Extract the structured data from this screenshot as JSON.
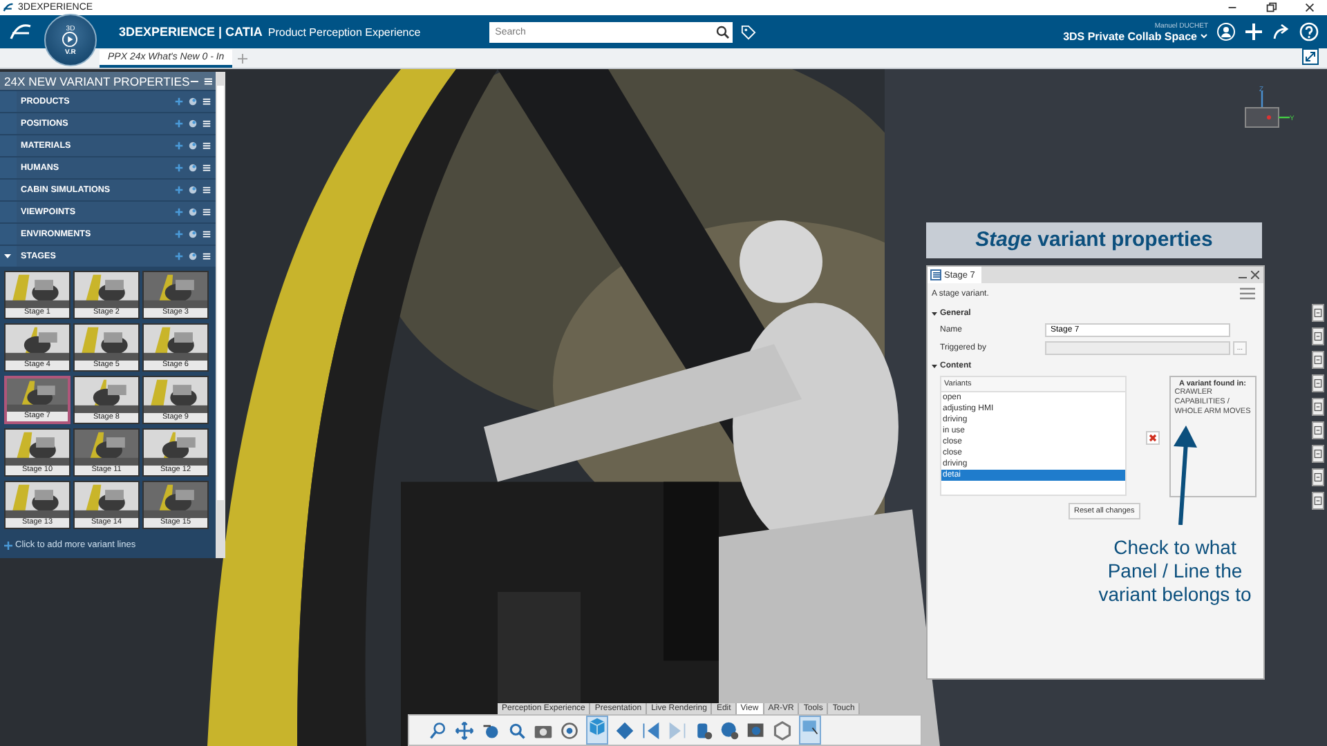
{
  "app_title": "3DEXPERIENCE",
  "header": {
    "brand": "3DEXPERIENCE | CATIA",
    "product": "Product Perception Experience",
    "compass_top": "3D",
    "compass_bottom": "V.R",
    "search": {
      "placeholder": "Search"
    },
    "user": "Manuel DUCHET",
    "space": "3DS Private Collab Space"
  },
  "tabs": [
    {
      "label": "PPX 24x What's New 0 - In",
      "selected": true
    }
  ],
  "variant_panel": {
    "title": "24X NEW VARIANT PROPERTIES",
    "categories": [
      {
        "label": "PRODUCTS",
        "expanded": false
      },
      {
        "label": "POSITIONS",
        "expanded": false
      },
      {
        "label": "MATERIALS",
        "expanded": false
      },
      {
        "label": "HUMANS",
        "expanded": false
      },
      {
        "label": "CABIN SIMULATIONS",
        "expanded": false
      },
      {
        "label": "VIEWPOINTS",
        "expanded": false
      },
      {
        "label": "ENVIRONMENTS",
        "expanded": false
      },
      {
        "label": "STAGES",
        "expanded": true
      }
    ],
    "stages": [
      {
        "label": "Stage 1",
        "selected": false
      },
      {
        "label": "Stage 2",
        "selected": false
      },
      {
        "label": "Stage 3",
        "selected": false
      },
      {
        "label": "Stage 4",
        "selected": false
      },
      {
        "label": "Stage 5",
        "selected": false
      },
      {
        "label": "Stage 6",
        "selected": false
      },
      {
        "label": "Stage 7",
        "selected": true
      },
      {
        "label": "Stage 8",
        "selected": false
      },
      {
        "label": "Stage 9",
        "selected": false
      },
      {
        "label": "Stage 10",
        "selected": false
      },
      {
        "label": "Stage 11",
        "selected": false
      },
      {
        "label": "Stage 12",
        "selected": false
      },
      {
        "label": "Stage 13",
        "selected": false
      },
      {
        "label": "Stage 14",
        "selected": false
      },
      {
        "label": "Stage 15",
        "selected": false
      }
    ],
    "add_hint": "Click to add more variant lines"
  },
  "stage_banner": "*Stage* variant properties",
  "dialog": {
    "tab": "Stage 7",
    "description": "A stage variant.",
    "general_title": "General",
    "fields": [
      {
        "label": "Name",
        "value": "Stage 7"
      },
      {
        "label": "Triggered by"
      }
    ],
    "browse_label": "...",
    "content_title": "Content",
    "variants_header": "Variants",
    "variants": [
      {
        "label": "open",
        "selected": false
      },
      {
        "label": "adjusting HMI",
        "selected": false
      },
      {
        "label": "driving",
        "selected": false
      },
      {
        "label": "in use",
        "selected": false
      },
      {
        "label": "close",
        "selected": false
      },
      {
        "label": "close",
        "selected": false
      },
      {
        "label": "driving",
        "selected": false
      },
      {
        "label": "detai",
        "selected": true
      }
    ],
    "found_in": {
      "title": "A variant found in:",
      "lines": [
        "CRAWLER",
        "CAPABILITIES /",
        "WHOLE ARM MOVES"
      ]
    },
    "reset_button": "Reset all changes"
  },
  "annotation": "Check to what Panel / Line the variant belongs to",
  "axis_labels": {
    "z": "Z",
    "y": "Y"
  },
  "toolbar": {
    "tabs": [
      {
        "label": "Perception Experience",
        "selected": false
      },
      {
        "label": "Presentation",
        "selected": false
      },
      {
        "label": "Live Rendering",
        "selected": false
      },
      {
        "label": "Edit",
        "selected": false
      },
      {
        "label": "View",
        "selected": true
      },
      {
        "label": "AR-VR",
        "selected": false
      },
      {
        "label": "Tools",
        "selected": false
      },
      {
        "label": "Touch",
        "selected": false
      }
    ]
  }
}
